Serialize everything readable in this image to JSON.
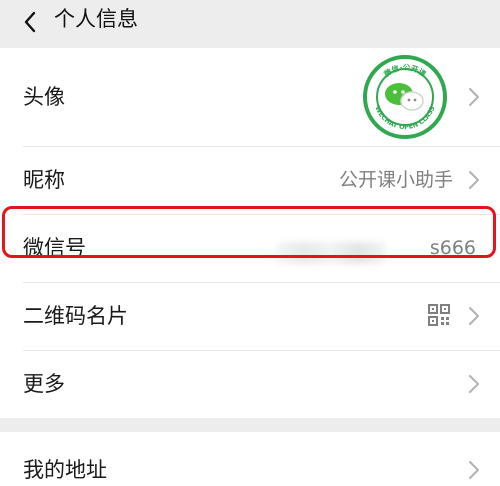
{
  "header": {
    "title": "个人信息"
  },
  "profile": {
    "avatar_label": "头像",
    "avatar_text_top": "微信·公开课",
    "avatar_text_bottom": "WECHAT OPEN CLASS",
    "nickname_label": "昵称",
    "nickname_value": "公开课小助手",
    "wechat_id_label": "微信号",
    "wechat_id_value_visible": "s666",
    "qr_label": "二维码名片",
    "more_label": "更多"
  },
  "address": {
    "label": "我的地址"
  },
  "colors": {
    "background": "#ededed",
    "highlight": "#e5141c",
    "brand_green": "#2fa84f"
  }
}
